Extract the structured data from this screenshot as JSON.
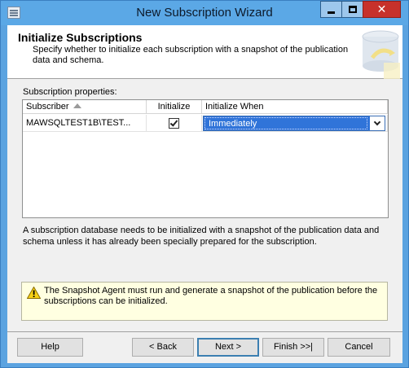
{
  "window": {
    "title": "New Subscription Wizard",
    "close_glyph": "✕"
  },
  "header": {
    "title": "Initialize Subscriptions",
    "description": "Specify whether to initialize each subscription with a snapshot of the publication data and schema."
  },
  "grid": {
    "section_label": "Subscription properties:",
    "columns": {
      "subscriber": "Subscriber",
      "initialize": "Initialize",
      "initialize_when": "Initialize When"
    },
    "rows": [
      {
        "subscriber": "MAWSQLTEST1B\\TEST...",
        "initialize": true,
        "initialize_when": "Immediately"
      }
    ]
  },
  "info_text": "A subscription database needs to be initialized with a snapshot of the publication data and schema unless it has already been specially prepared for the subscription.",
  "warning": {
    "icon": "warning-icon",
    "text": "The Snapshot Agent must run and generate a snapshot of the publication before the subscriptions can be initialized."
  },
  "buttons": {
    "help": "Help",
    "back": "< Back",
    "next": "Next >",
    "finish": "Finish >>|",
    "cancel": "Cancel"
  },
  "colors": {
    "selection": "#3074d9",
    "warning_bg": "#ffffe1",
    "titlebar": "#5ba8e6",
    "close": "#c7312b"
  }
}
